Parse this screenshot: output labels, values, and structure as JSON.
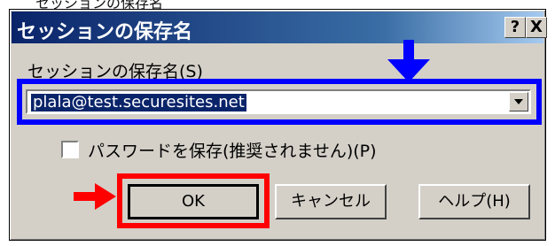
{
  "window": {
    "title": "セッションの保存名",
    "help_button": "?",
    "close_button": "X"
  },
  "fragment_text": "セッションの保存名",
  "session_name": {
    "label": "セッションの保存名(S)",
    "value": "plala@test.securesites.net"
  },
  "save_password": {
    "label": "パスワードを保存(推奨されません)(P)",
    "checked": false
  },
  "buttons": {
    "ok": "OK",
    "cancel": "キャンセル",
    "help": "ヘルプ(H)"
  },
  "annotations": {
    "blue_color": "#0000ff",
    "red_color": "#ff0000"
  }
}
